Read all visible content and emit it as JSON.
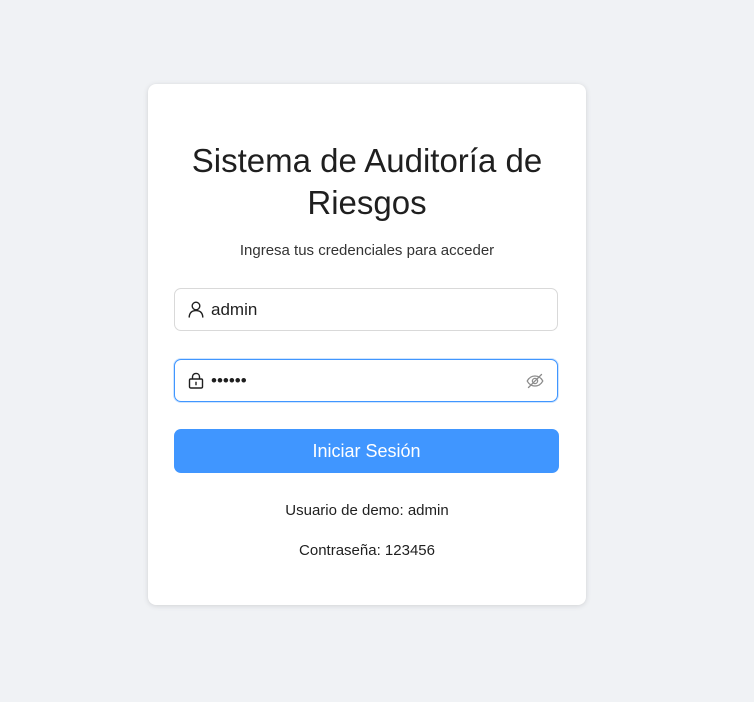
{
  "login": {
    "title": "Sistema de Auditoría de Riesgos",
    "subtitle": "Ingresa tus credenciales para acceder",
    "username_value": "admin",
    "password_value": "123456",
    "submit_label": "Iniciar Sesión",
    "demo_user": "Usuario de demo: admin",
    "demo_password": "Contraseña: 123456"
  },
  "icons": {
    "username_prefix": "user-icon",
    "password_prefix": "lock-icon",
    "password_toggle": "eye-invisible-icon"
  },
  "colors": {
    "background": "#f0f2f5",
    "primary": "#4096ff",
    "card": "#ffffff"
  }
}
